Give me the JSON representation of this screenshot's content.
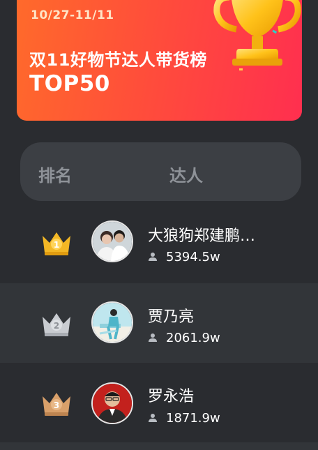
{
  "banner": {
    "date_range": "10/27-11/11",
    "title": "双11好物节达人带货榜",
    "subtitle": "TOP50"
  },
  "header": {
    "rank_label": "排名",
    "influencer_label": "达人"
  },
  "colors": {
    "banner_start": "#ff6a2b",
    "banner_end": "#ff2f4f",
    "gold": "#f3b725",
    "silver": "#c9ccd1",
    "bronze": "#d9a06a",
    "background": "#2a2c30"
  },
  "rankings": [
    {
      "rank": "1",
      "medal": "gold-crown-icon",
      "name": "大狼狗郑建鹏…",
      "fans": "5394.5w"
    },
    {
      "rank": "2",
      "medal": "silver-crown-icon",
      "name": "贾乃亮",
      "fans": "2061.9w"
    },
    {
      "rank": "3",
      "medal": "bronze-crown-icon",
      "name": "罗永浩",
      "fans": "1871.9w"
    }
  ]
}
